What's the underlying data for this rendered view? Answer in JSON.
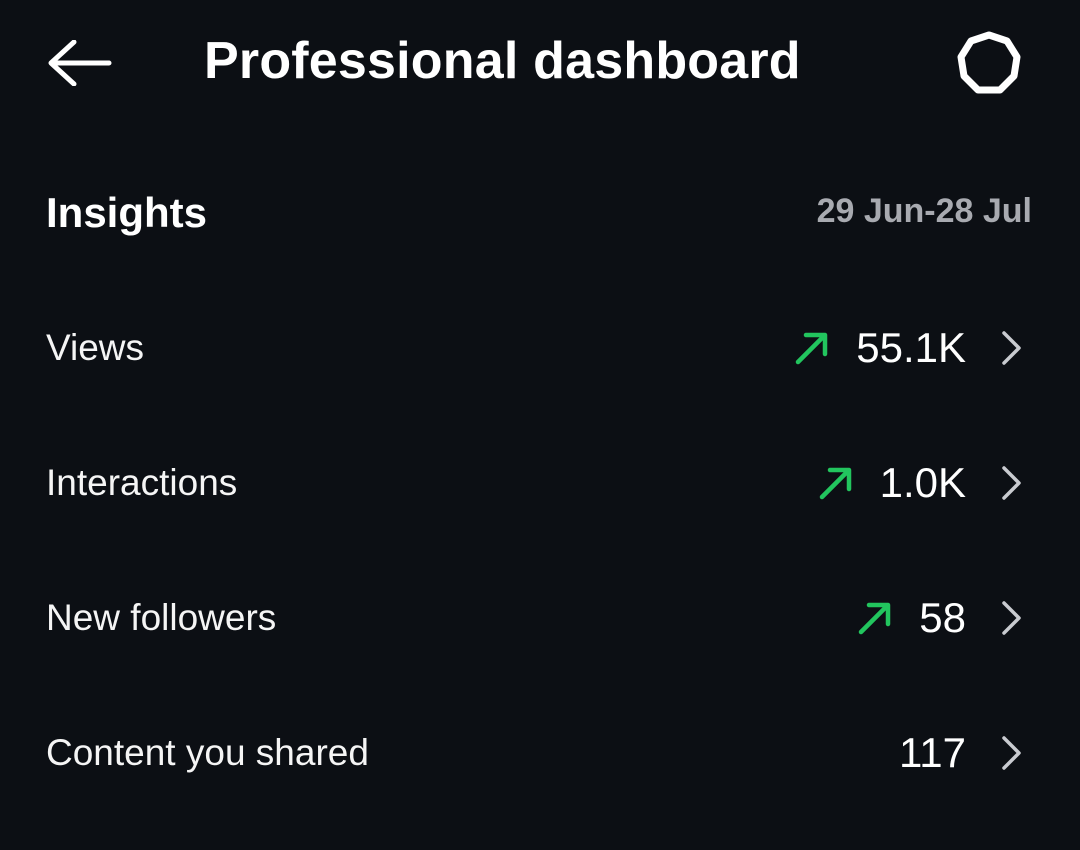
{
  "header": {
    "title": "Professional dashboard",
    "back_icon": "back-arrow-icon",
    "settings_icon": "gear-icon"
  },
  "insights": {
    "heading": "Insights",
    "date_range": "29 Jun-28 Jul"
  },
  "metrics": [
    {
      "label": "Views",
      "value": "55.1K",
      "trend": "up"
    },
    {
      "label": "Interactions",
      "value": "1.0K",
      "trend": "up"
    },
    {
      "label": "New followers",
      "value": "58",
      "trend": "up"
    },
    {
      "label": "Content you shared",
      "value": "117",
      "trend": "none"
    }
  ],
  "colors": {
    "background": "#0c0f14",
    "text": "#f5f5f5",
    "muted": "#a8aab0",
    "trend_up": "#22c55e",
    "chevron": "#c9cbd0"
  }
}
